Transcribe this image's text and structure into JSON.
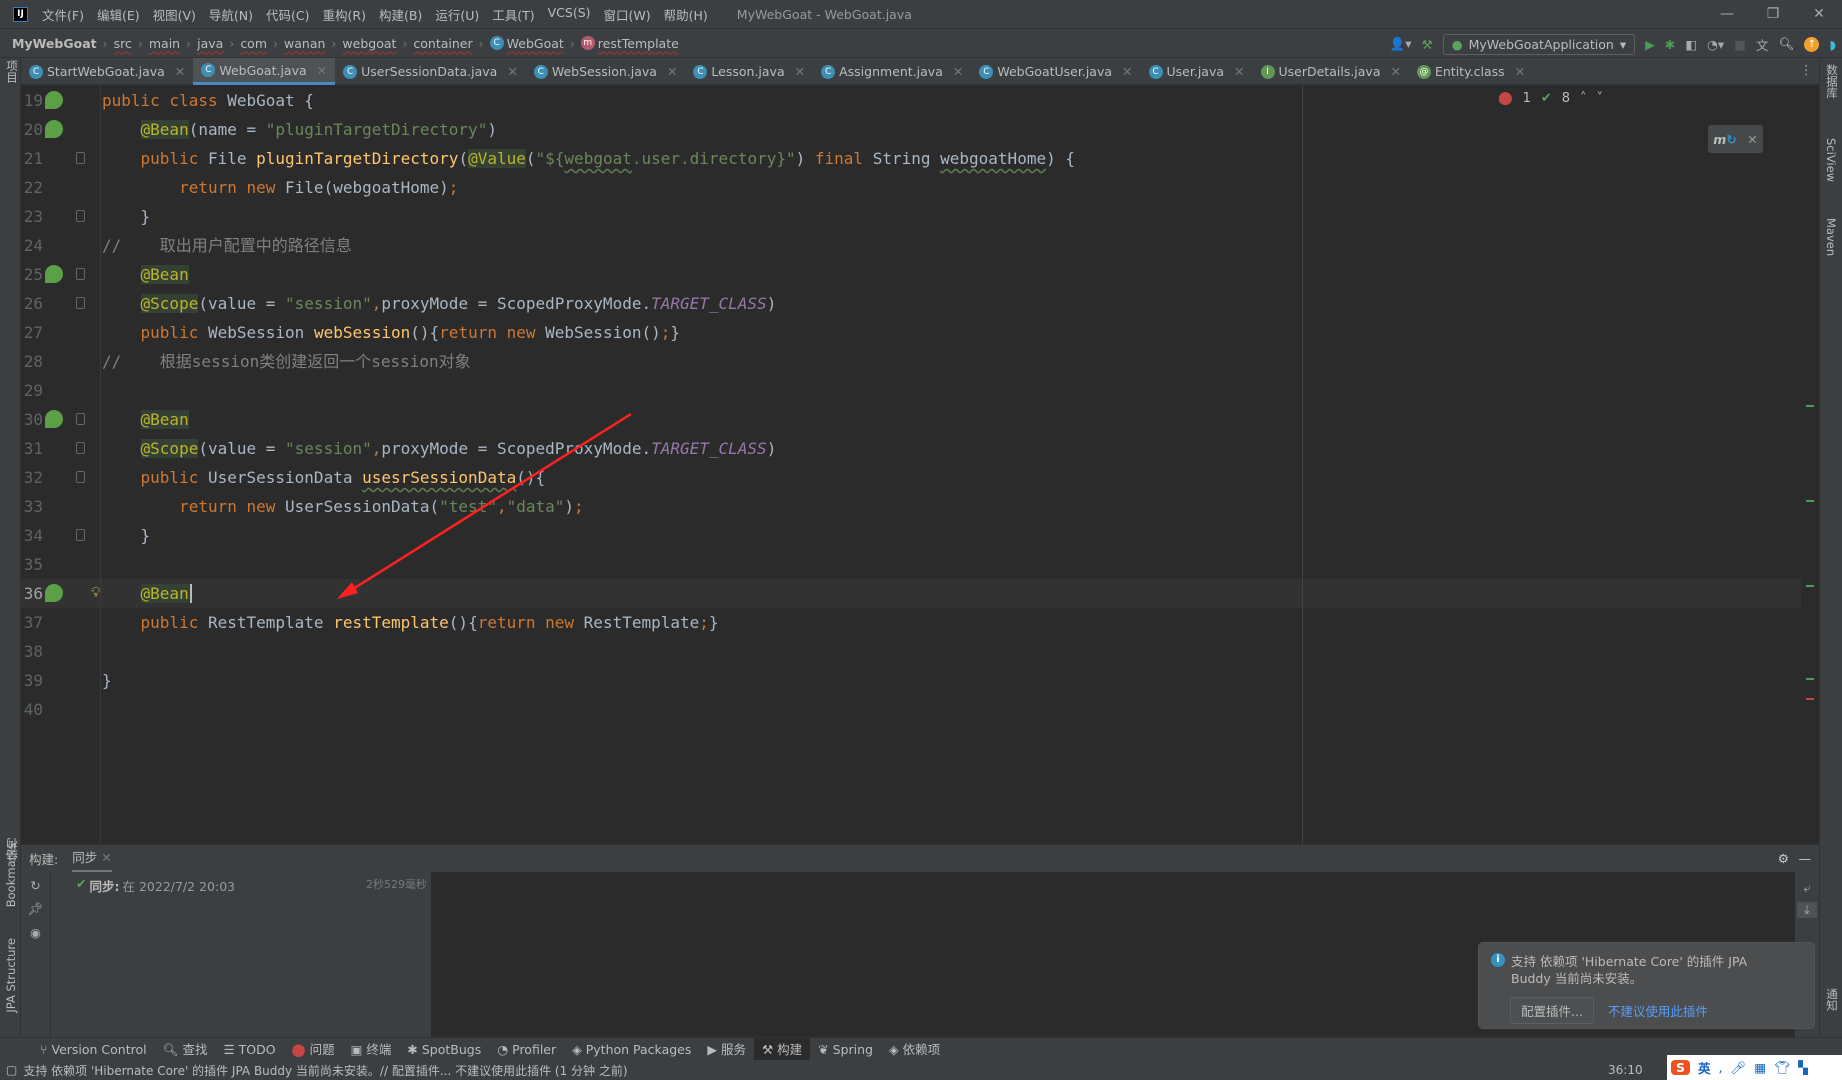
{
  "window": {
    "title": "MyWebGoat - WebGoat.java",
    "menu": [
      "文件(F)",
      "编辑(E)",
      "视图(V)",
      "导航(N)",
      "代码(C)",
      "重构(R)",
      "构建(B)",
      "运行(U)",
      "工具(T)",
      "VCS(S)",
      "窗口(W)",
      "帮助(H)"
    ],
    "logo": "IJ",
    "controls": [
      "—",
      "❐",
      "✕"
    ]
  },
  "breadcrumb": [
    "MyWebGoat",
    "src",
    "main",
    "java",
    "com",
    "wanan",
    "webgoat",
    "container",
    "WebGoat",
    "restTemplate"
  ],
  "toolbar": {
    "run_config": "MyWebGoatApplication",
    "run_config_status": "#ff0000"
  },
  "tabs": [
    {
      "label": "StartWebGoat.java",
      "icon": "C"
    },
    {
      "label": "WebGoat.java",
      "icon": "C",
      "active": true
    },
    {
      "label": "UserSessionData.java",
      "icon": "C"
    },
    {
      "label": "WebSession.java",
      "icon": "C"
    },
    {
      "label": "Lesson.java",
      "icon": "C"
    },
    {
      "label": "Assignment.java",
      "icon": "C"
    },
    {
      "label": "WebGoatUser.java",
      "icon": "C"
    },
    {
      "label": "User.java",
      "icon": "C"
    },
    {
      "label": "UserDetails.java",
      "icon": "I"
    },
    {
      "label": "Entity.class",
      "icon": "@"
    }
  ],
  "inspections": {
    "errors": "1",
    "warnings": "8"
  },
  "editor": {
    "current_line": 36,
    "lines": [
      {
        "n": 19,
        "icon": true,
        "t": [
          [
            "kw",
            "public class "
          ],
          [
            "",
            "WebGoat {"
          ]
        ]
      },
      {
        "n": 20,
        "icon": true,
        "t": [
          [
            "",
            "    "
          ],
          [
            "ann",
            "@Bean"
          ],
          [
            "",
            "(name = "
          ],
          [
            "str",
            "\"pluginTargetDirectory\""
          ],
          [
            "",
            ")"
          ]
        ]
      },
      {
        "n": 21,
        "fold": true,
        "t": [
          [
            "",
            "    "
          ],
          [
            "kw",
            "public "
          ],
          [
            "",
            "File "
          ],
          [
            "fn",
            "pluginTargetDirectory"
          ],
          [
            "",
            "("
          ],
          [
            "ann",
            "@Value"
          ],
          [
            "",
            "("
          ],
          [
            "str",
            "\"${"
          ],
          [
            "strw",
            "webgoat"
          ],
          [
            "str",
            ".user.directory}\""
          ],
          [
            "",
            ") "
          ],
          [
            "kw",
            "final "
          ],
          [
            "",
            "String "
          ],
          [
            "w",
            "webgoatHome"
          ],
          [
            "",
            ") {"
          ]
        ]
      },
      {
        "n": 22,
        "t": [
          [
            "",
            "        "
          ],
          [
            "kw",
            "return new "
          ],
          [
            "",
            "File(webgoatHome)"
          ],
          [
            "kw",
            ";"
          ]
        ]
      },
      {
        "n": 23,
        "fold": true,
        "t": [
          [
            "",
            "    }"
          ]
        ]
      },
      {
        "n": 24,
        "t": [
          [
            "cmt",
            "//    取出用户配置中的路径信息"
          ]
        ]
      },
      {
        "n": 25,
        "icon": true,
        "fold": true,
        "t": [
          [
            "",
            "    "
          ],
          [
            "ann",
            "@Bean"
          ]
        ]
      },
      {
        "n": 26,
        "fold": true,
        "t": [
          [
            "",
            "    "
          ],
          [
            "ann",
            "@Scope"
          ],
          [
            "",
            "(value = "
          ],
          [
            "str",
            "\"session\""
          ],
          [
            "kw",
            ","
          ],
          [
            "",
            "proxyMode = ScopedProxyMode."
          ],
          [
            "cst",
            "TARGET_CLASS"
          ],
          [
            "",
            ")"
          ]
        ]
      },
      {
        "n": 27,
        "t": [
          [
            "",
            "    "
          ],
          [
            "kw",
            "public "
          ],
          [
            "",
            "WebSession "
          ],
          [
            "fn",
            "webSession"
          ],
          [
            "",
            "(){"
          ],
          [
            "kw",
            "return new "
          ],
          [
            "",
            "WebSession()"
          ],
          [
            "kw",
            ";"
          ],
          [
            "",
            "}"
          ]
        ]
      },
      {
        "n": 28,
        "t": [
          [
            "cmt",
            "//    根据session类创建返回一个session对象"
          ]
        ]
      },
      {
        "n": 29,
        "t": []
      },
      {
        "n": 30,
        "icon": true,
        "fold": true,
        "t": [
          [
            "",
            "    "
          ],
          [
            "ann",
            "@Bean"
          ]
        ]
      },
      {
        "n": 31,
        "fold": true,
        "t": [
          [
            "",
            "    "
          ],
          [
            "ann",
            "@Scope"
          ],
          [
            "",
            "(value = "
          ],
          [
            "str",
            "\"session\""
          ],
          [
            "kw",
            ","
          ],
          [
            "",
            "proxyMode = ScopedProxyMode."
          ],
          [
            "cst",
            "TARGET_CLASS"
          ],
          [
            "",
            ")"
          ]
        ]
      },
      {
        "n": 32,
        "fold": true,
        "t": [
          [
            "",
            "    "
          ],
          [
            "kw",
            "public "
          ],
          [
            "",
            "UserSessionData "
          ],
          [
            "fnw",
            "usesrSessionData"
          ],
          [
            "",
            "(){"
          ]
        ]
      },
      {
        "n": 33,
        "t": [
          [
            "",
            "        "
          ],
          [
            "kw",
            "return new "
          ],
          [
            "",
            "UserSessionData("
          ],
          [
            "str",
            "\"test\""
          ],
          [
            "kw",
            ","
          ],
          [
            "str",
            "\"data\""
          ],
          [
            "",
            ")"
          ],
          [
            "kw",
            ";"
          ]
        ]
      },
      {
        "n": 34,
        "fold": true,
        "t": [
          [
            "",
            "    }"
          ]
        ]
      },
      {
        "n": 35,
        "t": []
      },
      {
        "n": 36,
        "icon": true,
        "bulb": true,
        "t": [
          [
            "",
            "    "
          ],
          [
            "ann",
            "@Bean"
          ]
        ]
      },
      {
        "n": 37,
        "t": [
          [
            "",
            "    "
          ],
          [
            "kw",
            "public "
          ],
          [
            "",
            "RestTemplate "
          ],
          [
            "fn",
            "restTemplate"
          ],
          [
            "",
            "(){"
          ],
          [
            "kw",
            "return new "
          ],
          [
            "",
            "RestTemplate"
          ],
          [
            "kw",
            ";"
          ],
          [
            "",
            "}"
          ]
        ]
      },
      {
        "n": 38,
        "t": []
      },
      {
        "n": 39,
        "t": [
          [
            "",
            "}"
          ]
        ]
      },
      {
        "n": 40,
        "t": []
      }
    ]
  },
  "right_strip": [
    "数据库",
    "SciView",
    "Maven",
    "通知"
  ],
  "left_strip": [
    "项目",
    "结构",
    "Bookmarks",
    "JPA Structure"
  ],
  "build": {
    "label": "构建:",
    "tab": "同步",
    "item_bold": "同步:",
    "item_text": " 在 2022/7/2 20:03",
    "duration": "2秒529毫秒"
  },
  "bottom_tools": [
    "Version Control",
    "查找",
    "TODO",
    "问题",
    "终端",
    "SpotBugs",
    "Profiler",
    "Python Packages",
    "服务",
    "构建",
    "Spring",
    "依赖项"
  ],
  "bottom_active": "构建",
  "status": {
    "message": "支持 依赖项 'Hibernate Core' 的插件 JPA Buddy 当前尚未安装。// 配置插件...   不建议使用此插件 (1 分钟 之前)",
    "position": "36:10"
  },
  "notification": {
    "text": "支持 依赖项 'Hibernate Core' 的插件 JPA Buddy 当前尚未安装。",
    "button": "配置插件...",
    "link": "不建议使用此插件"
  },
  "ime": {
    "label": "英"
  },
  "annotation_arrow_color": "#ff2020"
}
